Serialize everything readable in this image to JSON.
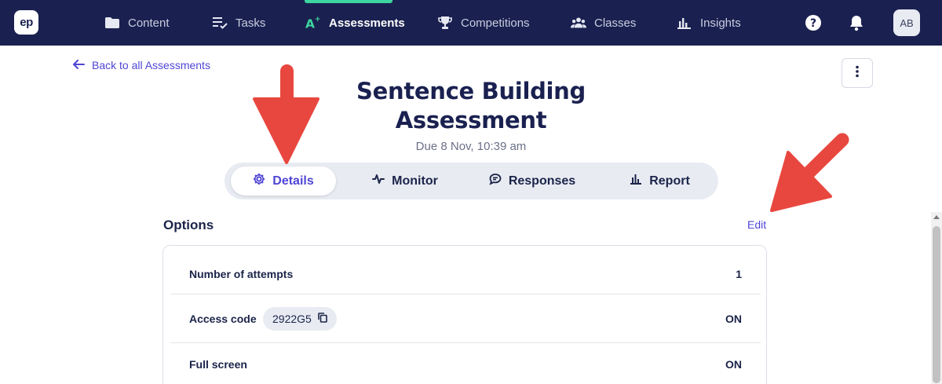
{
  "app": {
    "logo": "ep",
    "nav": [
      {
        "label": "Content",
        "icon": "folder-icon",
        "active": false
      },
      {
        "label": "Tasks",
        "icon": "tasks-icon",
        "active": false
      },
      {
        "label": "Assessments",
        "icon": "assessment-aplus-icon",
        "active": true
      },
      {
        "label": "Competitions",
        "icon": "trophy-icon",
        "active": false
      },
      {
        "label": "Classes",
        "icon": "people-icon",
        "active": false
      },
      {
        "label": "Insights",
        "icon": "bar-chart-icon",
        "active": false
      }
    ],
    "right_icons": [
      "help-icon",
      "bell-icon"
    ],
    "avatar": "AB"
  },
  "page": {
    "back_label": "Back to all Assessments",
    "title_line1": "Sentence Building",
    "title_line2": "Assessment",
    "due": "Due 8 Nov, 10:39 am",
    "tabs": [
      {
        "label": "Details",
        "icon": "gear-icon",
        "active": true
      },
      {
        "label": "Monitor",
        "icon": "pulse-icon",
        "active": false
      },
      {
        "label": "Responses",
        "icon": "chat-icon",
        "active": false
      },
      {
        "label": "Report",
        "icon": "bar-chart-icon",
        "active": false
      }
    ],
    "options": {
      "title": "Options",
      "edit_label": "Edit",
      "rows": [
        {
          "label": "Number of attempts",
          "value": "1"
        },
        {
          "label": "Access code",
          "code": "2922G5",
          "value": "ON"
        },
        {
          "label": "Full screen",
          "value": "ON"
        }
      ]
    }
  },
  "colors": {
    "nav_bg": "#1a2150",
    "accent_green": "#3ed6a0",
    "link_purple": "#4f46d6",
    "annotation_red": "#e8473f"
  }
}
